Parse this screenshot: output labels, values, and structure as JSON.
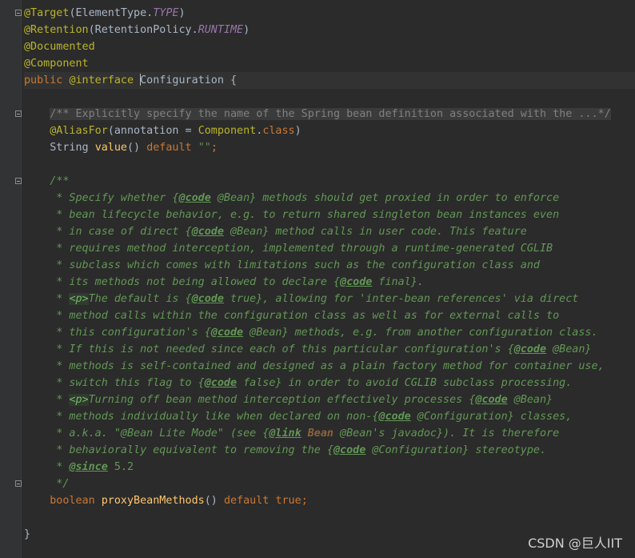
{
  "editor": {
    "lines": {
      "l1": [
        "@Target",
        "(ElementType.",
        "TYPE",
        ")"
      ],
      "l2": [
        "@Retention",
        "(RetentionPolicy.",
        "RUNTIME",
        ")"
      ],
      "l3": [
        "@Documented"
      ],
      "l4": [
        "@Component"
      ],
      "l5": [
        "public ",
        "@interface ",
        "Configuration",
        " {"
      ],
      "l7": "/** Explicitly specify the name of the Spring bean definition associated with the ...*/",
      "l8": [
        "@AliasFor",
        "(annotation = ",
        "Component",
        ".",
        "class",
        ")"
      ],
      "l9": [
        "String ",
        "value",
        "() ",
        "default ",
        "\"\"",
        ";"
      ],
      "l11": "/**",
      "l12": [
        " * Specify whether {",
        "@code",
        " @Bean} methods should get proxied in order to enforce"
      ],
      "l13": " * bean lifecycle behavior, e.g. to return shared singleton bean instances even",
      "l14": [
        " * in case of direct {",
        "@code",
        " @Bean} method calls in user code. This feature"
      ],
      "l15": " * requires method interception, implemented through a runtime-generated CGLIB",
      "l16": " * subclass which comes with limitations such as the configuration class and",
      "l17": [
        " * its methods not being allowed to declare {",
        "@code",
        " final}."
      ],
      "l18": [
        " * ",
        "<p>",
        "The default is {",
        "@code",
        " true}, allowing for 'inter-bean references' via direct"
      ],
      "l19": " * method calls within the configuration class as well as for external calls to",
      "l20": [
        " * this configuration's {",
        "@code",
        " @Bean} methods, e.g. from another configuration class."
      ],
      "l21": [
        " * If this is not needed since each of this particular configuration's {",
        "@code",
        " @Bean}"
      ],
      "l22": " * methods is self-contained and designed as a plain factory method for container use,",
      "l23": [
        " * switch this flag to {",
        "@code",
        " false} in order to avoid CGLIB subclass processing."
      ],
      "l24": [
        " * ",
        "<p>",
        "Turning off bean method interception effectively processes {",
        "@code",
        " @Bean}"
      ],
      "l25": [
        " * methods individually like when declared on non-{",
        "@code",
        " @Configuration} classes,"
      ],
      "l26": [
        " * a.k.a. \"@Bean Lite Mode\" (see {",
        "@link",
        " ",
        "Bean",
        " @Bean's javadoc}). It is therefore"
      ],
      "l27": [
        " * behaviorally equivalent to removing the {",
        "@code",
        " @Configuration} stereotype."
      ],
      "l28": [
        " * ",
        "@since",
        " 5.2"
      ],
      "l29": " */",
      "l30": [
        "boolean ",
        "proxyBeanMethods",
        "() ",
        "default ",
        "true",
        ";"
      ],
      "l32": "}"
    }
  },
  "watermark": "CSDN @巨人IIT",
  "colors": {
    "background": "#2b2b2b",
    "annotation": "#bbb529",
    "keyword": "#cc7832",
    "javadoc": "#629755",
    "method": "#ffc66d",
    "string": "#6a8759",
    "constant": "#9876aa"
  }
}
